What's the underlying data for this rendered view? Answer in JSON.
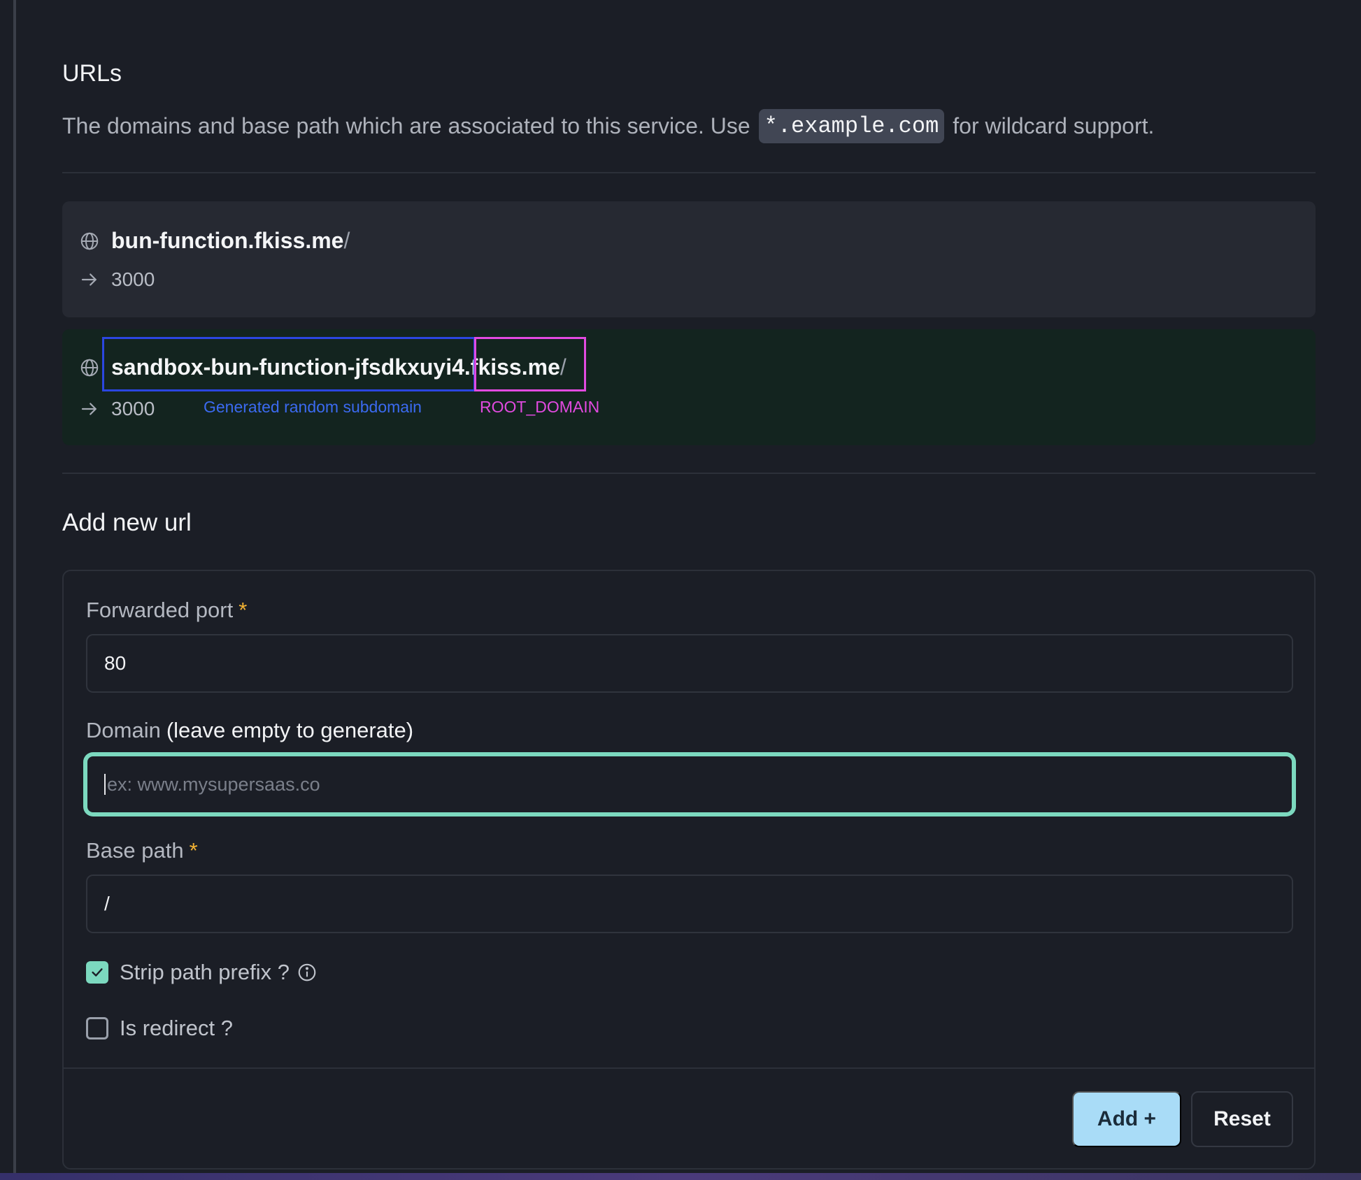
{
  "section": {
    "title": "URLs",
    "description_before": "The domains and base path which are associated to this service. Use",
    "description_code": "*.example.com",
    "description_after": "for wildcard support."
  },
  "urls": [
    {
      "domain": "bun-function.fkiss.me",
      "path": "/",
      "port": "3000"
    },
    {
      "domain_sub": "sandbox-bun-function-jfsdkxuyi4.",
      "domain_root": "fkiss.me",
      "path": "/",
      "port": "3000"
    }
  ],
  "annotations": {
    "subdomain_label": "Generated random subdomain",
    "root_label": "ROOT_DOMAIN",
    "subdomain_color": "#2b46e0",
    "root_color": "#e24ae0"
  },
  "form": {
    "title": "Add new url",
    "port_label": "Forwarded port",
    "required_mark": "*",
    "port_value": "80",
    "domain_label": "Domain",
    "domain_hint": "(leave empty to generate)",
    "domain_placeholder": "ex: www.mysupersaas.co",
    "base_path_label": "Base path",
    "base_path_value": "/",
    "strip_prefix_label": "Strip path prefix ?",
    "strip_prefix_checked": true,
    "redirect_label": "Is redirect ?",
    "redirect_checked": false,
    "add_label": "Add +",
    "reset_label": "Reset"
  },
  "colors": {
    "accent": "#7cd9bf",
    "add_button": "#a9dcf7",
    "required": "#f2b233"
  }
}
